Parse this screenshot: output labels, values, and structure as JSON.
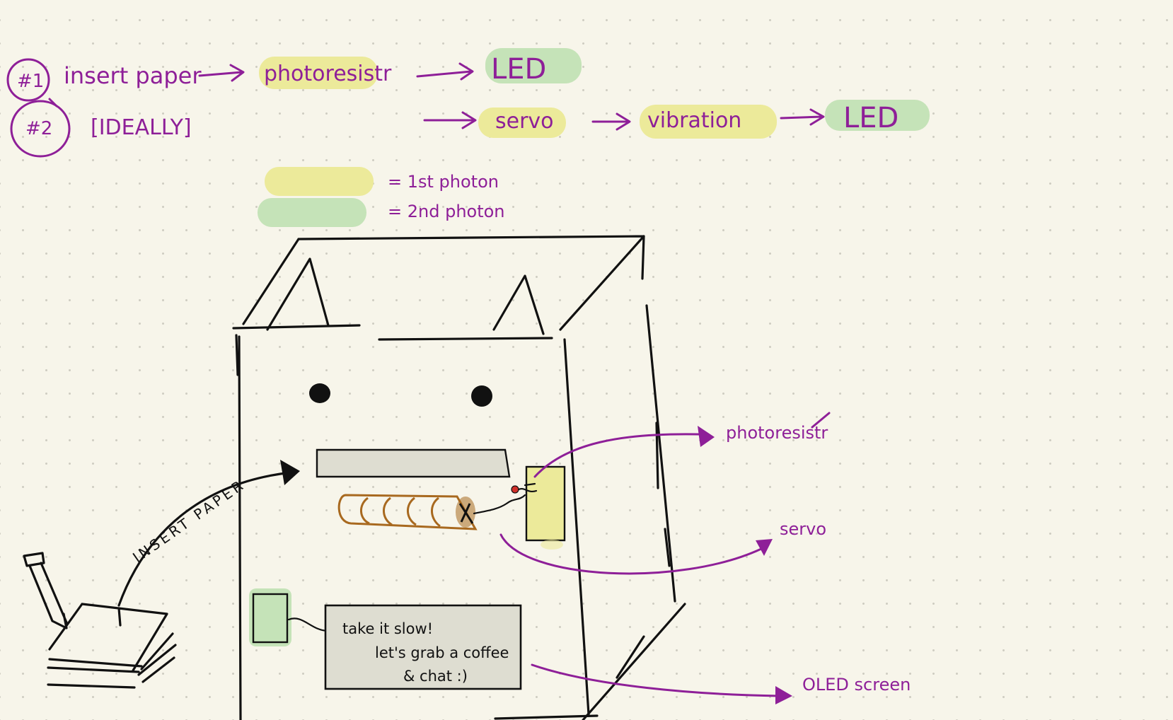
{
  "flow": {
    "step1": {
      "badge": "#1",
      "action": "insert paper",
      "nodes": [
        "photoresistr",
        "LED"
      ]
    },
    "step2": {
      "badge": "#2",
      "action": "[IDEALLY]",
      "nodes": [
        "servo",
        "vibration",
        "LED"
      ]
    }
  },
  "legend": {
    "first": "= 1st photon",
    "second": "= 2nd photon",
    "first_color": "#ecea9a",
    "second_color": "#c5e3b8"
  },
  "sketch": {
    "insert_label": "INSERT PAPER",
    "screen_lines": [
      "take it slow!",
      "let's grab a coffee",
      "& chat :)"
    ]
  },
  "callouts": {
    "photoresistor": "photoresistr",
    "servo": "servo",
    "oled": "OLED screen"
  },
  "colors": {
    "ink": "#8e1f98",
    "yellow_highlight": "#ecea9a",
    "green_highlight": "#c5e3b8",
    "servo_brown": "#a8691f",
    "led_red": "#d0302a"
  }
}
